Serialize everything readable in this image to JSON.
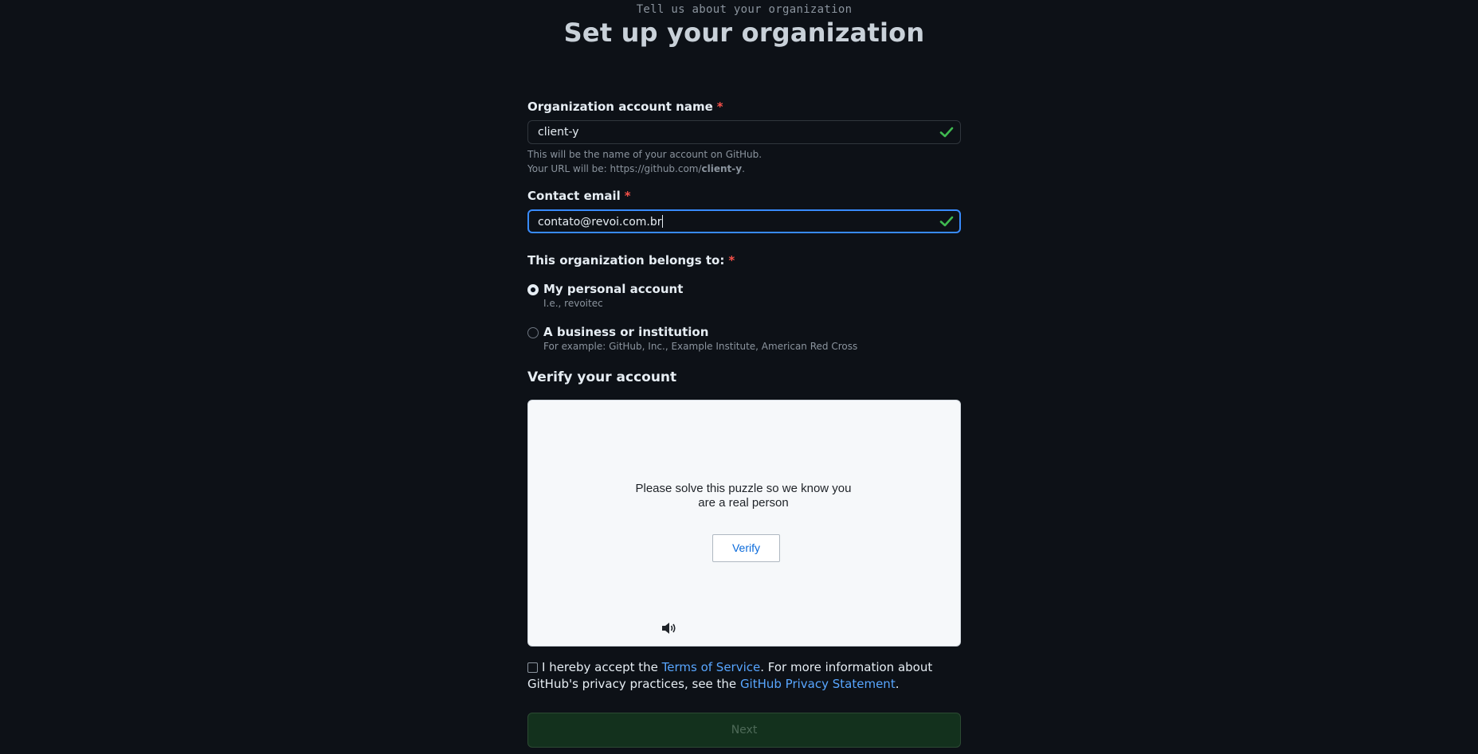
{
  "header": {
    "subtitle": "Tell us about your organization",
    "title": "Set up your organization"
  },
  "org_name": {
    "label": "Organization account name",
    "required_mark": "*",
    "value": "client-y",
    "valid_icon": "check-icon",
    "note_line1": "This will be the name of your account on GitHub.",
    "note_line2_prefix": "Your URL will be: https://github.com/",
    "note_line2_name": "client-y",
    "note_line2_suffix": "."
  },
  "contact_email": {
    "label": "Contact email",
    "required_mark": "*",
    "value": "contato@revoi.com.br",
    "valid_icon": "check-icon"
  },
  "belongs_to": {
    "label": "This organization belongs to:",
    "required_mark": "*",
    "options": [
      {
        "label": "My personal account",
        "note": "I.e., revoitec",
        "checked": true
      },
      {
        "label": "A business or institution",
        "note": "For example: GitHub, Inc., Example Institute, American Red Cross",
        "checked": false
      }
    ]
  },
  "verify": {
    "title": "Verify your account",
    "puzzle_text": "Please solve this puzzle so we know you are a real person",
    "button_label": "Verify",
    "audio_icon": "speaker-icon"
  },
  "terms": {
    "prefix": "I hereby accept the ",
    "tos_link": "Terms of Service",
    "middle": ". For more information about GitHub's privacy practices, see the ",
    "privacy_link": "GitHub Privacy Statement",
    "suffix": "."
  },
  "next": {
    "label": "Next"
  },
  "colors": {
    "background": "#0d1117",
    "required": "#f85149",
    "valid": "#3fb950",
    "link": "#58a6ff",
    "focus": "#388bfd"
  }
}
